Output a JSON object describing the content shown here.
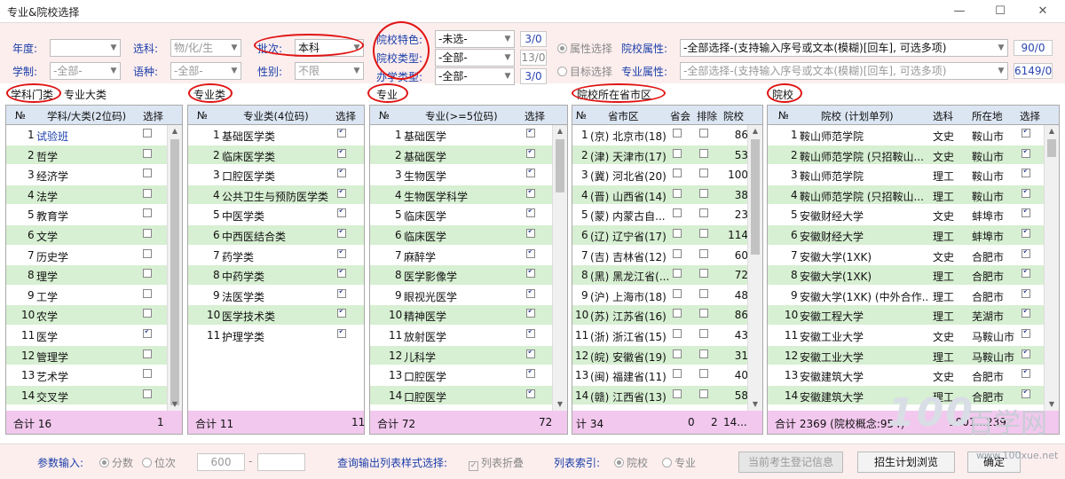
{
  "window": {
    "title": "专业&院校选择",
    "min": "—",
    "max": "☐",
    "close": "✕"
  },
  "filters": {
    "year_label": "年度:",
    "year_value": "",
    "subject_label": "选科:",
    "subject_value": "物/化/生",
    "batch_label": "批次:",
    "batch_value": "本科",
    "length_label": "学制:",
    "length_value": "-全部-",
    "language_label": "语种:",
    "language_value": "-全部-",
    "gender_label": "性别:",
    "gender_value": "不限",
    "feature_label": "院校特色:",
    "feature_value": "-未选-",
    "feature_count": "3/0",
    "type_label": "院校类型:",
    "type_value": "-全部-",
    "type_count": "13/0",
    "run_label": "办学类型:",
    "run_value": "-全部-",
    "run_count": "3/0",
    "attr_radio": "属性选择",
    "attr_label": "院校属性:",
    "attr_value": "-全部选择-(支持输入序号或文本(模糊)[回车], 可选多项)",
    "attr_count": "90/0",
    "target_radio": "目标选择",
    "major_attr_label": "专业属性:",
    "major_attr_value": "-全部选择-(支持输入序号或文本(模糊)[回车], 可选多项)",
    "major_attr_count": "6149/0"
  },
  "sections": {
    "s1": "学科门类",
    "s1b": "专业大类",
    "s2": "专业类",
    "s3": "专业",
    "s4": "院校所在省市区",
    "s5": "院校"
  },
  "panel1": {
    "headers": [
      "№",
      "学科/大类(2位码)",
      "选择"
    ],
    "rows": [
      {
        "n": "1",
        "name": "试验班",
        "c": false,
        "link": true
      },
      {
        "n": "2",
        "name": "哲学",
        "c": false
      },
      {
        "n": "3",
        "name": "经济学",
        "c": false
      },
      {
        "n": "4",
        "name": "法学",
        "c": false
      },
      {
        "n": "5",
        "name": "教育学",
        "c": false
      },
      {
        "n": "6",
        "name": "文学",
        "c": false
      },
      {
        "n": "7",
        "name": "历史学",
        "c": false
      },
      {
        "n": "8",
        "name": "理学",
        "c": false
      },
      {
        "n": "9",
        "name": "工学",
        "c": false
      },
      {
        "n": "10",
        "name": "农学",
        "c": false
      },
      {
        "n": "11",
        "name": "医学",
        "c": true
      },
      {
        "n": "12",
        "name": "管理学",
        "c": false
      },
      {
        "n": "13",
        "name": "艺术学",
        "c": false
      },
      {
        "n": "14",
        "name": "交叉学",
        "c": false
      }
    ],
    "foot_label": "合计 16",
    "foot_value": "1"
  },
  "panel2": {
    "headers": [
      "№",
      "专业类(4位码)",
      "选择"
    ],
    "rows": [
      {
        "n": "1",
        "name": "基础医学类",
        "c": true
      },
      {
        "n": "2",
        "name": "临床医学类",
        "c": true
      },
      {
        "n": "3",
        "name": "口腔医学类",
        "c": true
      },
      {
        "n": "4",
        "name": "公共卫生与预防医学类",
        "c": true
      },
      {
        "n": "5",
        "name": "中医学类",
        "c": true
      },
      {
        "n": "6",
        "name": "中西医结合类",
        "c": true
      },
      {
        "n": "7",
        "name": "药学类",
        "c": true
      },
      {
        "n": "8",
        "name": "中药学类",
        "c": true
      },
      {
        "n": "9",
        "name": "法医学类",
        "c": true
      },
      {
        "n": "10",
        "name": "医学技术类",
        "c": true
      },
      {
        "n": "11",
        "name": "护理学类",
        "c": true
      }
    ],
    "foot_label": "合计 11",
    "foot_value": "11"
  },
  "panel3": {
    "headers": [
      "№",
      "专业(>=5位码)",
      "选择"
    ],
    "rows": [
      {
        "n": "1",
        "name": "基础医学",
        "c": true
      },
      {
        "n": "2",
        "name": "基础医学",
        "c": true
      },
      {
        "n": "3",
        "name": "生物医学",
        "c": true
      },
      {
        "n": "4",
        "name": "生物医学科学",
        "c": true
      },
      {
        "n": "5",
        "name": "临床医学",
        "c": true
      },
      {
        "n": "6",
        "name": "临床医学",
        "c": true
      },
      {
        "n": "7",
        "name": "麻醉学",
        "c": true
      },
      {
        "n": "8",
        "name": "医学影像学",
        "c": true
      },
      {
        "n": "9",
        "name": "眼视光医学",
        "c": true
      },
      {
        "n": "10",
        "name": "精神医学",
        "c": true
      },
      {
        "n": "11",
        "name": "放射医学",
        "c": true
      },
      {
        "n": "12",
        "name": "儿科学",
        "c": true
      },
      {
        "n": "13",
        "name": "口腔医学",
        "c": true
      },
      {
        "n": "14",
        "name": "口腔医学",
        "c": true
      }
    ],
    "foot_label": "合计 72",
    "foot_value": "72"
  },
  "panel4": {
    "headers": [
      "№",
      "省市区",
      "省会",
      "排除",
      "院校"
    ],
    "rows": [
      {
        "n": "1",
        "name": "(京) 北京市(18)",
        "v": "86"
      },
      {
        "n": "2",
        "name": "(津) 天津市(17)",
        "v": "53"
      },
      {
        "n": "3",
        "name": "(冀) 河北省(20)",
        "v": "100"
      },
      {
        "n": "4",
        "name": "(晋) 山西省(14)",
        "v": "38"
      },
      {
        "n": "5",
        "name": "(蒙) 内蒙古自...",
        "v": "23"
      },
      {
        "n": "6",
        "name": "(辽) 辽宁省(17)",
        "v": "114"
      },
      {
        "n": "7",
        "name": "(吉) 吉林省(12)",
        "v": "60"
      },
      {
        "n": "8",
        "name": "(黑) 黑龙江省(...",
        "v": "72"
      },
      {
        "n": "9",
        "name": "(沪) 上海市(18)",
        "v": "48"
      },
      {
        "n": "10",
        "name": "(苏) 江苏省(16)",
        "v": "86"
      },
      {
        "n": "11",
        "name": "(浙) 浙江省(15)",
        "v": "43"
      },
      {
        "n": "12",
        "name": "(皖) 安徽省(19)",
        "v": "31"
      },
      {
        "n": "13",
        "name": "(闽) 福建省(11)",
        "v": "40"
      },
      {
        "n": "14",
        "name": "(赣) 江西省(13)",
        "v": "58"
      }
    ],
    "foot_label": "计 34",
    "foot_a": "0",
    "foot_b": "2",
    "foot_c": "14..."
  },
  "panel5": {
    "headers": [
      "№",
      "院校 (计划单列)",
      "选科",
      "所在地",
      "选择"
    ],
    "rows": [
      {
        "n": "1",
        "name": "鞍山师范学院",
        "s": "文史",
        "city": "鞍山市"
      },
      {
        "n": "2",
        "name": "鞍山师范学院 (只招鞍山...",
        "s": "文史",
        "city": "鞍山市"
      },
      {
        "n": "3",
        "name": "鞍山师范学院",
        "s": "理工",
        "city": "鞍山市"
      },
      {
        "n": "4",
        "name": "鞍山师范学院 (只招鞍山...",
        "s": "理工",
        "city": "鞍山市"
      },
      {
        "n": "5",
        "name": "安徽财经大学",
        "s": "文史",
        "city": "蚌埠市"
      },
      {
        "n": "6",
        "name": "安徽财经大学",
        "s": "理工",
        "city": "蚌埠市"
      },
      {
        "n": "7",
        "name": "安徽大学(1XK)",
        "s": "文史",
        "city": "合肥市"
      },
      {
        "n": "8",
        "name": "安徽大学(1XK)",
        "s": "理工",
        "city": "合肥市"
      },
      {
        "n": "9",
        "name": "安徽大学(1XK) (中外合作...",
        "s": "理工",
        "city": "合肥市"
      },
      {
        "n": "10",
        "name": "安徽工程大学",
        "s": "理工",
        "city": "芜湖市"
      },
      {
        "n": "11",
        "name": "安徽工业大学",
        "s": "文史",
        "city": "马鞍山市"
      },
      {
        "n": "12",
        "name": "安徽工业大学",
        "s": "理工",
        "city": "马鞍山市"
      },
      {
        "n": "13",
        "name": "安徽建筑大学",
        "s": "文史",
        "city": "合肥市"
      },
      {
        "n": "14",
        "name": "安徽建筑大学",
        "s": "理工",
        "city": "合肥市"
      }
    ],
    "foot_label": "合计 2369 (院校概念:954)",
    "foot_a": "1001...",
    "foot_b": "239"
  },
  "bottom": {
    "param_label": "参数输入:",
    "score_radio": "分数",
    "rank_radio": "位次",
    "from_value": "600",
    "dash": "-",
    "to_value": "",
    "style_label": "查询输出列表样式选择:",
    "fold_label": "列表折叠",
    "index_label": "列表索引:",
    "idx_school": "院校",
    "idx_major": "专业",
    "btn_current": "当前考生登记信息",
    "btn_plan": "招生计划浏览",
    "btn_ok": "确定"
  },
  "watermark": {
    "brand": "100",
    "cn": "百学网",
    "url": "www.100xue.net"
  },
  "colors": {
    "accent_blue": "#1a3ea8",
    "row_alt": "#d7efd2",
    "header": "#dce6f3",
    "footer": "#f2c8ee",
    "top_bg": "#fdeeee",
    "annotation_red": "#e01414"
  }
}
